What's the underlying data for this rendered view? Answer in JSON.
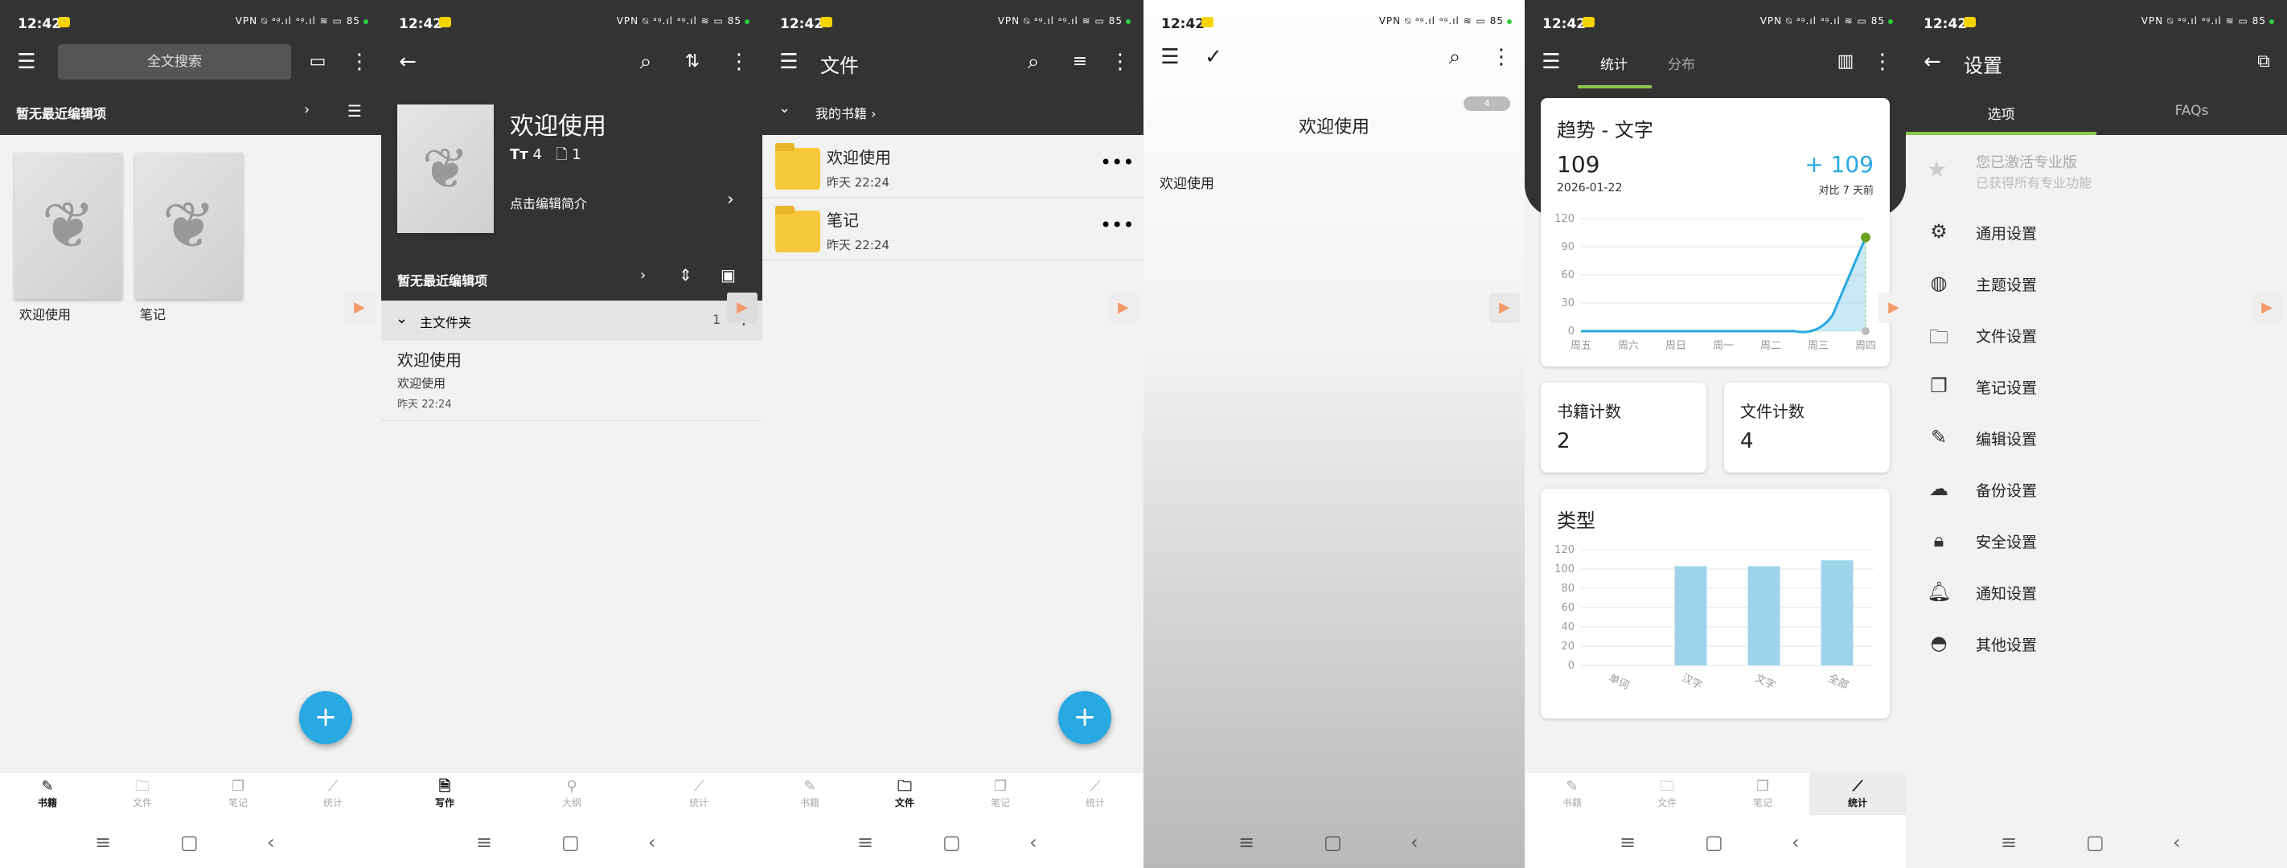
{
  "status": {
    "time": "12:42",
    "icons": "VPN ⍉ ᵃᵍ.ıl ᵃᵍ.ıl ≋ ▭",
    "battery": "85"
  },
  "p1": {
    "search_placeholder": "全文搜索",
    "recent": "暂无最近编辑项",
    "books": [
      {
        "title": "欢迎使用"
      },
      {
        "title": "笔记"
      }
    ],
    "nav": [
      {
        "label": "书籍",
        "icon": "book-pen-icon"
      },
      {
        "label": "文件",
        "icon": "folder-icon"
      },
      {
        "label": "笔记",
        "icon": "notes-icon"
      },
      {
        "label": "统计",
        "icon": "chart-icon"
      }
    ]
  },
  "p2": {
    "title": "欢迎使用",
    "meta_count1": "4",
    "meta_count2": "1",
    "edit_intro": "点击编辑简介",
    "recent": "暂无最近编辑项",
    "folder_label": "主文件夹",
    "folder_count": "1",
    "entry": {
      "title": "欢迎使用",
      "preview": "欢迎使用",
      "time": "昨天 22:24"
    },
    "nav": [
      {
        "label": "写作"
      },
      {
        "label": "大纲"
      },
      {
        "label": "统计"
      }
    ]
  },
  "p3": {
    "title": "文件",
    "breadcrumb": "我的书籍",
    "files": [
      {
        "name": "欢迎使用",
        "time": "昨天 22:24"
      },
      {
        "name": "笔记",
        "time": "昨天 22:24"
      }
    ],
    "nav": [
      {
        "label": "书籍"
      },
      {
        "label": "文件"
      },
      {
        "label": "笔记"
      },
      {
        "label": "统计"
      }
    ]
  },
  "p4": {
    "badge": "4",
    "heading": "欢迎使用",
    "body": "欢迎使用"
  },
  "p5": {
    "tabs": [
      {
        "label": "统计"
      },
      {
        "label": "分布"
      }
    ],
    "trend": {
      "title": "趋势 - 文字",
      "value": "109",
      "date": "2026-01-22",
      "delta": "+ 109",
      "delta_label": "对比 7 天前"
    },
    "books_count": {
      "label": "书籍计数",
      "value": "2"
    },
    "files_count": {
      "label": "文件计数",
      "value": "4"
    },
    "type_title": "类型",
    "nav": [
      {
        "label": "书籍"
      },
      {
        "label": "文件"
      },
      {
        "label": "笔记"
      },
      {
        "label": "统计"
      }
    ]
  },
  "p6": {
    "title": "设置",
    "tabs": [
      {
        "label": "选项"
      },
      {
        "label": "FAQs"
      }
    ],
    "pro": {
      "title": "您已激活专业版",
      "subtitle": "已获得所有专业功能"
    },
    "items": [
      {
        "label": "通用设置",
        "icon": "gear-icon"
      },
      {
        "label": "主题设置",
        "icon": "palette-icon"
      },
      {
        "label": "文件设置",
        "icon": "folder-icon"
      },
      {
        "label": "笔记设置",
        "icon": "notes-icon"
      },
      {
        "label": "编辑设置",
        "icon": "pencil-icon"
      },
      {
        "label": "备份设置",
        "icon": "cloud-upload-icon"
      },
      {
        "label": "安全设置",
        "icon": "lock-icon"
      },
      {
        "label": "通知设置",
        "icon": "bell-icon"
      },
      {
        "label": "其他设置",
        "icon": "android-icon"
      }
    ]
  },
  "chart_data": [
    {
      "type": "area",
      "categories": [
        "周五",
        "周六",
        "周日",
        "周一",
        "周二",
        "周三",
        "周四"
      ],
      "values": [
        0,
        0,
        0,
        0,
        0,
        0,
        100
      ],
      "ylim": [
        0,
        120
      ],
      "yticks": [
        "120",
        "90",
        "60",
        "30",
        "0"
      ],
      "grid": true
    },
    {
      "type": "bar",
      "categories": [
        "单词",
        "汉字",
        "文字",
        "全部"
      ],
      "values": [
        0,
        103,
        103,
        109
      ],
      "ylim": [
        0,
        120
      ],
      "yticks": [
        "120",
        "100",
        "80",
        "60",
        "40",
        "20",
        "0"
      ],
      "grid": true
    }
  ],
  "colors": {
    "accent": "#29a9e1",
    "dark": "#333333",
    "green": "#8bc34a",
    "bar": "#9ed4ea"
  }
}
